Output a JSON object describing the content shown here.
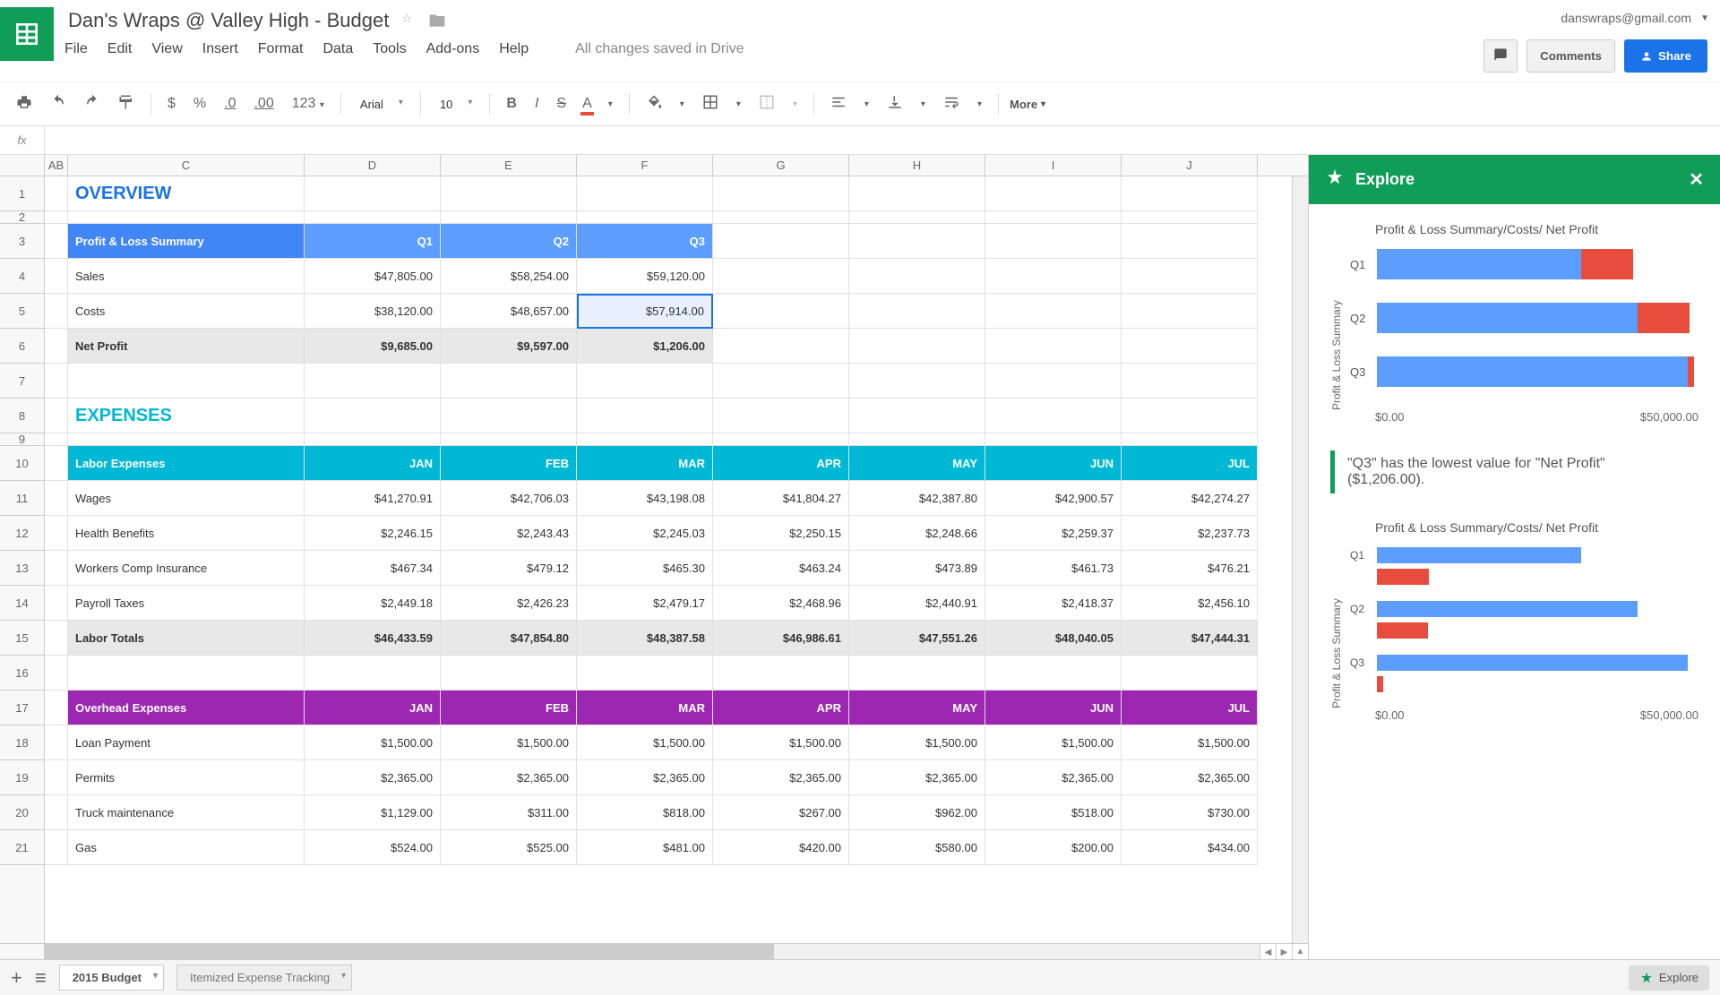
{
  "doc_title": "Dan's Wraps @ Valley High - Budget",
  "user_email": "danswraps@gmail.com",
  "save_status": "All changes saved in Drive",
  "menu": [
    "File",
    "Edit",
    "View",
    "Insert",
    "Format",
    "Data",
    "Tools",
    "Add-ons",
    "Help"
  ],
  "buttons": {
    "comments": "Comments",
    "share": "Share",
    "more": "More",
    "explore": "Explore"
  },
  "toolbar": {
    "font": "Arial",
    "size": "10",
    "currency": "$",
    "percent": "%",
    "dec_less": ".0",
    "dec_more": ".00",
    "numfmt": "123"
  },
  "columns": [
    "AB",
    "C",
    "D",
    "E",
    "F",
    "G",
    "H",
    "I",
    "J"
  ],
  "sections": {
    "overview": "OVERVIEW",
    "expenses": "EXPENSES",
    "pl_summary": "Profit & Loss Summary",
    "labor_expenses": "Labor Expenses",
    "overhead_expenses": "Overhead Expenses"
  },
  "quarters": [
    "Q1",
    "Q2",
    "Q3"
  ],
  "months": [
    "JAN",
    "FEB",
    "MAR",
    "APR",
    "MAY",
    "JUN",
    "JUL"
  ],
  "pl_rows": [
    {
      "label": "Sales",
      "vals": [
        "$47,805.00",
        "$58,254.00",
        "$59,120.00"
      ]
    },
    {
      "label": "Costs",
      "vals": [
        "$38,120.00",
        "$48,657.00",
        "$57,914.00"
      ]
    },
    {
      "label": "Net Profit",
      "vals": [
        "$9,685.00",
        "$9,597.00",
        "$1,206.00"
      ],
      "total": true
    }
  ],
  "labor_rows": [
    {
      "label": "Wages",
      "vals": [
        "$41,270.91",
        "$42,706.03",
        "$43,198.08",
        "$41,804.27",
        "$42,387.80",
        "$42,900.57",
        "$42,274.27"
      ]
    },
    {
      "label": "Health Benefits",
      "vals": [
        "$2,246.15",
        "$2,243.43",
        "$2,245.03",
        "$2,250.15",
        "$2,248.66",
        "$2,259.37",
        "$2,237.73"
      ]
    },
    {
      "label": "Workers Comp Insurance",
      "vals": [
        "$467.34",
        "$479.12",
        "$465.30",
        "$463.24",
        "$473.89",
        "$461.73",
        "$476.21"
      ]
    },
    {
      "label": "Payroll Taxes",
      "vals": [
        "$2,449.18",
        "$2,426.23",
        "$2,479.17",
        "$2,468.96",
        "$2,440.91",
        "$2,418.37",
        "$2,456.10"
      ]
    },
    {
      "label": "Labor Totals",
      "vals": [
        "$46,433.59",
        "$47,854.80",
        "$48,387.58",
        "$46,986.61",
        "$47,551.26",
        "$48,040.05",
        "$47,444.31"
      ],
      "total": true
    }
  ],
  "overhead_rows": [
    {
      "label": "Loan Payment",
      "vals": [
        "$1,500.00",
        "$1,500.00",
        "$1,500.00",
        "$1,500.00",
        "$1,500.00",
        "$1,500.00",
        "$1,500.00"
      ]
    },
    {
      "label": "Permits",
      "vals": [
        "$2,365.00",
        "$2,365.00",
        "$2,365.00",
        "$2,365.00",
        "$2,365.00",
        "$2,365.00",
        "$2,365.00"
      ]
    },
    {
      "label": "Truck maintenance",
      "vals": [
        "$1,129.00",
        "$311.00",
        "$818.00",
        "$267.00",
        "$962.00",
        "$518.00",
        "$730.00"
      ]
    },
    {
      "label": "Gas",
      "vals": [
        "$524.00",
        "$525.00",
        "$481.00",
        "$420.00",
        "$580.00",
        "$200.00",
        "$434.00"
      ]
    }
  ],
  "explore": {
    "title": "Explore",
    "chart_title": "Profit & Loss Summary/Costs/ Net Profit",
    "ylabel": "Profit & Loss Summary",
    "axis_min": "$0.00",
    "axis_max": "$50,000.00",
    "insight": "\"Q3\" has the lowest value for \"Net Profit\" ($1,206.00)."
  },
  "tabs": {
    "active": "2015 Budget",
    "other": "Itemized Expense Tracking"
  },
  "chart_data": [
    {
      "type": "bar",
      "orientation": "horizontal",
      "stacked": true,
      "title": "Profit & Loss Summary/Costs/ Net Profit",
      "ylabel": "Profit & Loss Summary",
      "xlabel": "",
      "xlim": [
        0,
        60000
      ],
      "categories": [
        "Q1",
        "Q2",
        "Q3"
      ],
      "series": [
        {
          "name": "Costs",
          "color": "#5c9eff",
          "values": [
            38120,
            48657,
            57914
          ]
        },
        {
          "name": "Net Profit",
          "color": "#e74c3c",
          "values": [
            9685,
            9597,
            1206
          ]
        }
      ],
      "x_ticks": [
        "$0.00",
        "$50,000.00"
      ]
    },
    {
      "type": "bar",
      "orientation": "horizontal",
      "stacked": false,
      "title": "Profit & Loss Summary/Costs/ Net Profit",
      "ylabel": "Profit & Loss Summary",
      "xlabel": "",
      "xlim": [
        0,
        60000
      ],
      "categories": [
        "Q1",
        "Q2",
        "Q3"
      ],
      "series": [
        {
          "name": "Costs",
          "color": "#5c9eff",
          "values": [
            38120,
            48657,
            57914
          ]
        },
        {
          "name": "Net Profit",
          "color": "#e74c3c",
          "values": [
            9685,
            9597,
            1206
          ]
        }
      ],
      "x_ticks": [
        "$0.00",
        "$50,000.00"
      ]
    }
  ]
}
